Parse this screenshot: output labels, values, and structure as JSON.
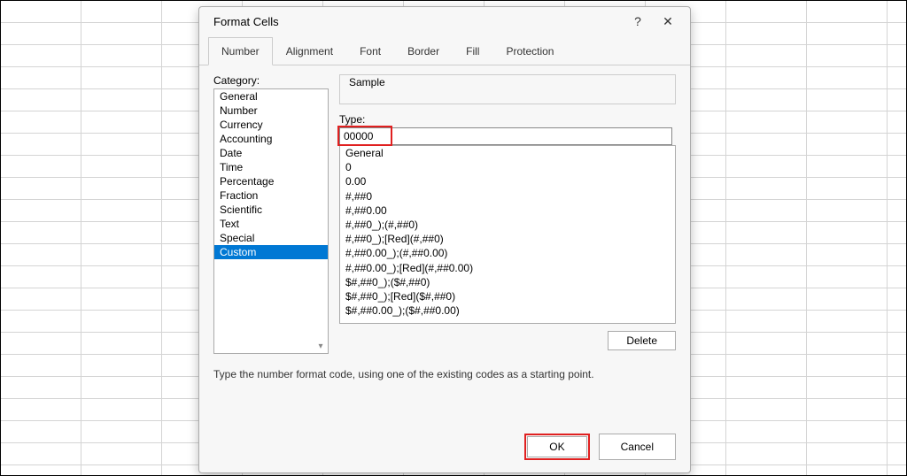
{
  "dialog": {
    "title": "Format Cells",
    "help_label": "?",
    "close_label": "✕"
  },
  "tabs": {
    "number": "Number",
    "alignment": "Alignment",
    "font": "Font",
    "border": "Border",
    "fill": "Fill",
    "protection": "Protection"
  },
  "number_panel": {
    "category_label": "Category:",
    "sample_label": "Sample",
    "type_label": "Type:",
    "type_value": "00000",
    "delete_label": "Delete",
    "hint": "Type the number format code, using one of the existing codes as a starting point."
  },
  "categories": [
    "General",
    "Number",
    "Currency",
    "Accounting",
    "Date",
    "Time",
    "Percentage",
    "Fraction",
    "Scientific",
    "Text",
    "Special",
    "Custom"
  ],
  "selected_category_index": 11,
  "format_codes": [
    "General",
    "0",
    "0.00",
    "#,##0",
    "#,##0.00",
    "#,##0_);(#,##0)",
    "#,##0_);[Red](#,##0)",
    "#,##0.00_);(#,##0.00)",
    "#,##0.00_);[Red](#,##0.00)",
    "$#,##0_);($#,##0)",
    "$#,##0_);[Red]($#,##0)",
    "$#,##0.00_);($#,##0.00)"
  ],
  "buttons": {
    "ok": "OK",
    "cancel": "Cancel"
  }
}
